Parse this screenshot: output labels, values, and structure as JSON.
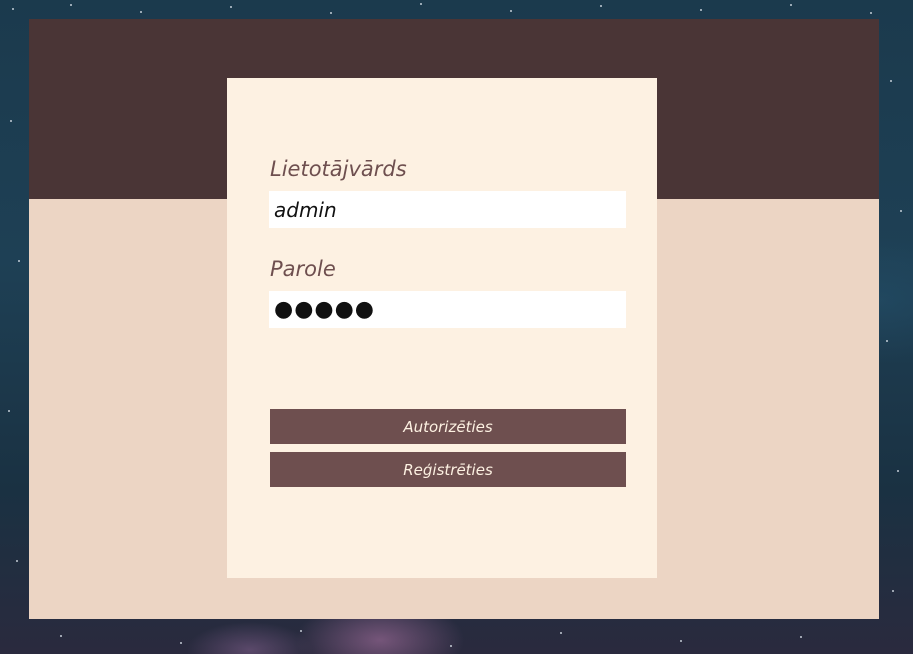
{
  "login_form": {
    "username_label": "Lietotājvārds",
    "username_value": "admin",
    "password_label": "Parole",
    "password_value": "●●●●●",
    "login_button": "Autorizēties",
    "register_button": "Reģistrēties"
  },
  "colors": {
    "header_band": "#4a3536",
    "frame_background": "#ecd5c4",
    "card_background": "#fdf1e2",
    "button_background": "#6e4f4f",
    "label_color": "#6e4f4f"
  }
}
